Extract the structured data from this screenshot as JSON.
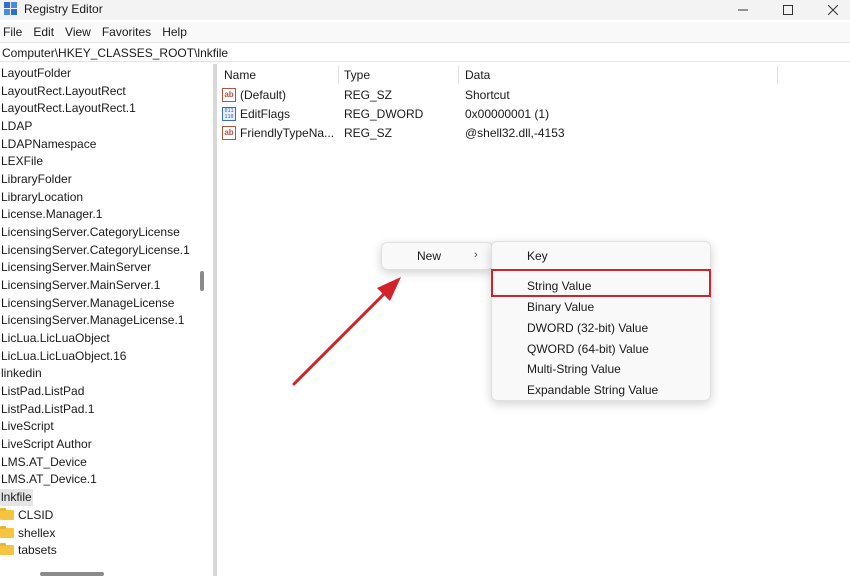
{
  "window": {
    "title": "Registry Editor",
    "controls": {
      "minimize": "—",
      "maximize": "☐",
      "close": "✕"
    }
  },
  "menubar": [
    "File",
    "Edit",
    "View",
    "Favorites",
    "Help"
  ],
  "address": {
    "path": "Computer\\HKEY_CLASSES_ROOT\\lnkfile"
  },
  "tree": {
    "items": [
      "LayoutFolder",
      "LayoutRect.LayoutRect",
      "LayoutRect.LayoutRect.1",
      "LDAP",
      "LDAPNamespace",
      "LEXFile",
      "LibraryFolder",
      "LibraryLocation",
      "License.Manager.1",
      "LicensingServer.CategoryLicense",
      "LicensingServer.CategoryLicense.1",
      "LicensingServer.MainServer",
      "LicensingServer.MainServer.1",
      "LicensingServer.ManageLicense",
      "LicensingServer.ManageLicense.1",
      "LicLua.LicLuaObject",
      "LicLua.LicLuaObject.16",
      "linkedin",
      "ListPad.ListPad",
      "ListPad.ListPad.1",
      "LiveScript",
      "LiveScript Author",
      "LMS.AT_Device",
      "LMS.AT_Device.1",
      "lnkfile"
    ],
    "selected": "lnkfile",
    "children": [
      "CLSID",
      "shellex",
      "tabsets"
    ]
  },
  "values": {
    "columns": {
      "name": "Name",
      "type": "Type",
      "data": "Data"
    },
    "rows": [
      {
        "icon": "string-value-icon",
        "name": "(Default)",
        "type": "REG_SZ",
        "data": "Shortcut"
      },
      {
        "icon": "binary-value-icon",
        "name": "EditFlags",
        "type": "REG_DWORD",
        "data": "0x00000001 (1)"
      },
      {
        "icon": "string-value-icon",
        "name": "FriendlyTypeNa...",
        "type": "REG_SZ",
        "data": "@shell32.dll,-4153"
      }
    ]
  },
  "context_menu": {
    "new_label": "New",
    "chevron": "›",
    "submenu": [
      "Key",
      "String Value",
      "Binary Value",
      "DWORD (32-bit) Value",
      "QWORD (64-bit) Value",
      "Multi-String Value",
      "Expandable String Value"
    ],
    "highlighted": "String Value"
  },
  "annotation": {
    "color": "#d2232a"
  }
}
